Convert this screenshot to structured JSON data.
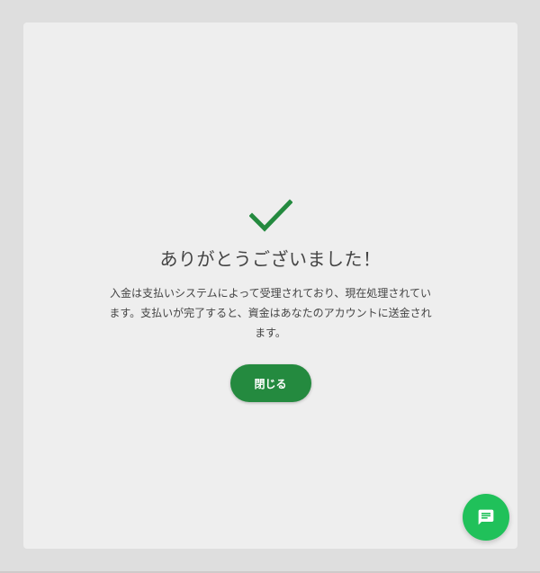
{
  "dialog": {
    "title": "ありがとうございました！",
    "message": "入金は支払いシステムによって受理されており、現在処理されています。支払いが完了すると、資金はあなたのアカウントに送金されます。",
    "close_label": "閉じる",
    "success_icon": "checkmark-icon",
    "accent_color": "#248a3f"
  },
  "chat": {
    "icon": "chat-icon",
    "color": "#20c15a"
  }
}
